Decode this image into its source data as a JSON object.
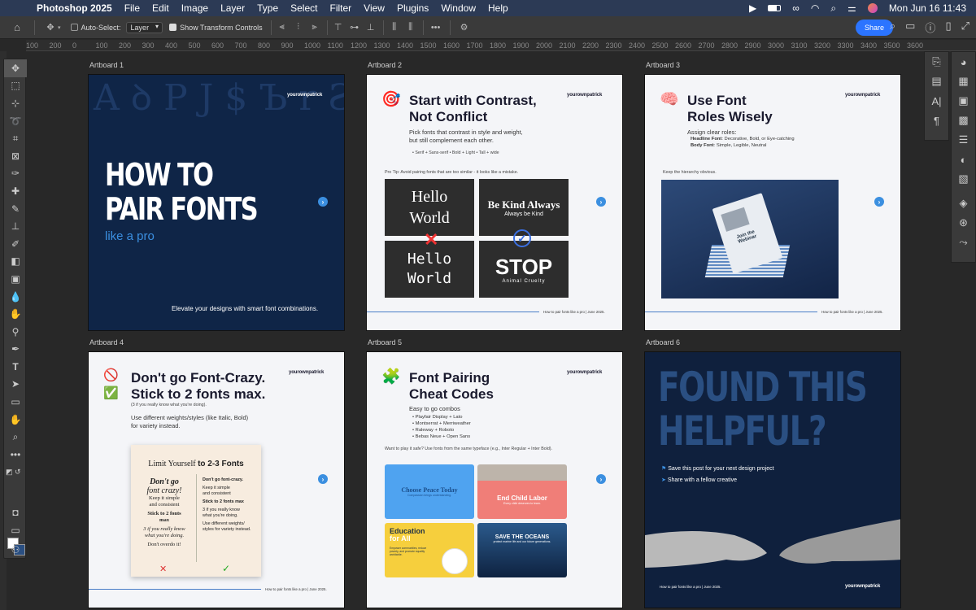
{
  "menubar": {
    "app": "Photoshop 2025",
    "items": [
      "File",
      "Edit",
      "Image",
      "Layer",
      "Type",
      "Select",
      "Filter",
      "View",
      "Plugins",
      "Window",
      "Help"
    ],
    "datetime": "Mon Jun 16  11:43"
  },
  "options": {
    "auto_select": "Auto-Select:",
    "layer_select": "Layer",
    "show_transform": "Show Transform Controls",
    "share": "Share"
  },
  "ruler": [
    "100",
    "200",
    "0",
    "100",
    "200",
    "300",
    "400",
    "500",
    "600",
    "700",
    "800",
    "900",
    "1000",
    "1100",
    "1200",
    "1300",
    "1400",
    "1500",
    "1600",
    "1700",
    "1800",
    "1900",
    "2000",
    "2100",
    "2200",
    "2300",
    "2400",
    "2500",
    "2600",
    "2700",
    "2800",
    "2900",
    "3000",
    "3100",
    "3200",
    "3300",
    "3400",
    "3500",
    "3600"
  ],
  "artboards": {
    "a1": {
      "label": "Artboard 1",
      "line1": "HOW TO",
      "line2": "PAIR FONTS",
      "script": "like a pro",
      "logo": "yourownpatrick",
      "bottom": "Elevate your designs with smart font combinations."
    },
    "a2": {
      "label": "Artboard 2",
      "title1": "Start with Contrast,",
      "title2": "Not Conflict",
      "body1": "Pick fonts that contrast in style and weight,",
      "body2": "but still complement each other.",
      "bullets": "•  Serif + Sans-serif   •  Bold + Light   •  Tall + wide",
      "tip": "Pro Tip: Avoid pairing fonts that are too similar - it looks like a mistake.",
      "ex1a": "Hello",
      "ex1b": "World",
      "ex2a": "Be Kind Always",
      "ex2b": "Always be Kind",
      "ex3a": "Hello",
      "ex3b": "World",
      "ex4a": "STOP",
      "ex4b": "Animal Cruelty",
      "logo": "yourownpatrick",
      "footer": "How to pair fonts like a pro | June 2025."
    },
    "a3": {
      "label": "Artboard 3",
      "title1": "Use Font",
      "title2": "Roles Wisely",
      "intro": "Assign clear roles:",
      "b1k": "Headline Font",
      "b1v": ": Decorative, Bold, or Eye-catching",
      "b2k": "Body Font",
      "b2v": ": Simple, Legible, Neutral",
      "note": "Keep the hierarchy obvious.",
      "paper": "Join the Webinar",
      "logo": "yourownpatrick",
      "footer": "How to pair fonts like a pro | June 2025."
    },
    "a4": {
      "label": "Artboard 4",
      "title1": "Don't go Font-Crazy.",
      "title2": "Stick to 2 fonts max.",
      "paren": "(3 if you really know what you're doing).",
      "body1": "Use different weights/styles (like Italic, Bold)",
      "body2": "for variety instead.",
      "card_title_a": "Limit Yourself ",
      "card_title_b": "to 2-3 Fonts",
      "l1": "Don't go",
      "l2": "font crazy!",
      "l3": "Keep it simple",
      "l4": "and consistent",
      "l5": "Stick to 2 fonts",
      "l6": "max",
      "l7": "3 if you really know",
      "l8": "what you're doing.",
      "l9": "Don't overdo it!",
      "r1": "Don't go font-crazy.",
      "r2": "Keep it simple",
      "r3": "and consistent",
      "r4": "Stick to 2 fonts max",
      "r5": "3 if you really know",
      "r6": "what you're doing.",
      "r7": "Use different weights/",
      "r8": "styles for variety instead.",
      "logo": "yourownpatrick",
      "footer": "How to pair fonts like a pro | June 2025."
    },
    "a5": {
      "label": "Artboard 5",
      "title1": "Font Pairing",
      "title2": "Cheat Codes",
      "intro": "Easy to go combos",
      "combos": [
        "Playfair Display + Lato",
        "Montserrat + Merriweather",
        "Raleway + Roboto",
        "Bebas Neue + Open Sans"
      ],
      "tip": "Want to play it safe? Use fonts from the same typeface (e.g., Inter Regular + Inter Bold).",
      "c1": "Choose Peace Today",
      "c1s": "Compassion brings understanding.",
      "c2": "End Child Labor",
      "c2s": "Every child deserves to learn.",
      "c3a": "Education",
      "c3b": "for All",
      "c3s": "Empower communities, reduce poverty, and promote equality worldwide.",
      "c4": "SAVE THE OCEANS",
      "c4s": "protect marine life and our future generations.",
      "logo": "yourownpatrick"
    },
    "a6": {
      "label": "Artboard 6",
      "line1": "FOUND THIS",
      "line2": "HELPFUL?",
      "save": "Save this post for your next design project",
      "share": "Share with a fellow creative",
      "footer": "How to pair fonts like a pro | June 2025.",
      "logo": "yourownpatrick"
    }
  },
  "colors": {
    "accent": "#3b8fe0",
    "navy": "#14233f",
    "menubar": "#2c3a55"
  }
}
